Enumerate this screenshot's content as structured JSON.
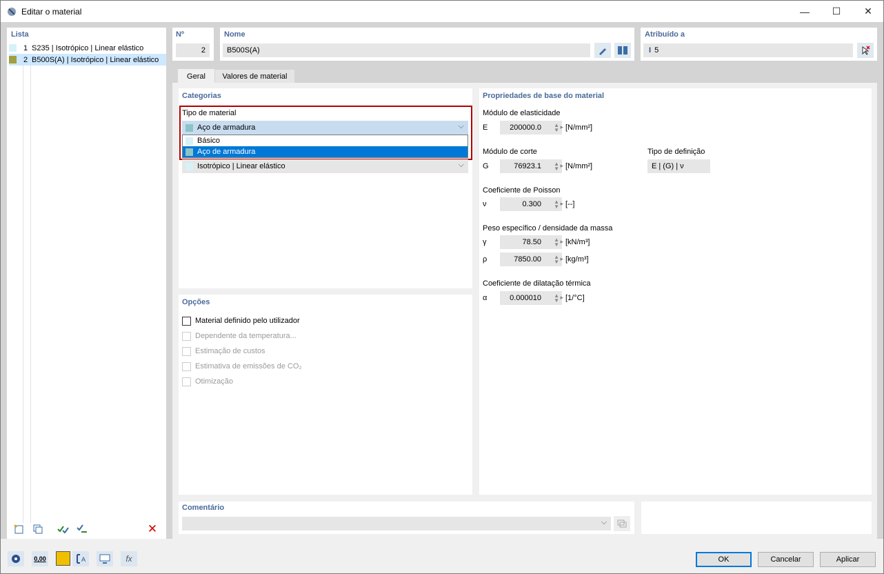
{
  "window": {
    "title": "Editar o material",
    "minimize": "—",
    "maximize": "☐",
    "close": "✕"
  },
  "list": {
    "header": "Lista",
    "items": [
      {
        "num": "1",
        "label": "S235 | Isotrópico | Linear elástico",
        "color": "#d6f2f8"
      },
      {
        "num": "2",
        "label": "B500S(A) | Isotrópico | Linear elástico",
        "color": "#a0a040"
      }
    ]
  },
  "no": {
    "header": "Nº",
    "value": "2"
  },
  "name": {
    "header": "Nome",
    "value": "B500S(A)"
  },
  "assigned": {
    "header": "Atribuído a",
    "value": "5"
  },
  "tabs": [
    "Geral",
    "Valores de material"
  ],
  "categories": {
    "header": "Categorias",
    "material_type_label": "Tipo de material",
    "selected": "Aço de armadura",
    "options": [
      "Básico",
      "Aço de armadura"
    ],
    "model_value": "Isotrópico | Linear elástico"
  },
  "options": {
    "header": "Opções",
    "items": [
      {
        "label": "Material definido pelo utilizador",
        "enabled": true
      },
      {
        "label": "Dependente da temperatura...",
        "enabled": false
      },
      {
        "label": "Estimação de custos",
        "enabled": false
      },
      {
        "label": "Estimativa de emissões de CO₂",
        "enabled": false
      },
      {
        "label": "Otimização",
        "enabled": false
      }
    ]
  },
  "props": {
    "header": "Propriedades de base do material",
    "elastic_label": "Módulo de elasticidade",
    "E_sym": "E",
    "E_val": "200000.0",
    "E_unit": "[N/mm²]",
    "shear_label": "Módulo de corte",
    "G_sym": "G",
    "G_val": "76923.1",
    "G_unit": "[N/mm²]",
    "deftype_label": "Tipo de definição",
    "deftype_val": "E | (G) | ν",
    "poisson_label": "Coeficiente de Poisson",
    "nu_sym": "ν",
    "nu_val": "0.300",
    "nu_unit": "[--]",
    "weight_label": "Peso específico / densidade da massa",
    "gamma_sym": "γ",
    "gamma_val": "78.50",
    "gamma_unit": "[kN/m³]",
    "rho_sym": "ρ",
    "rho_val": "7850.00",
    "rho_unit": "[kg/m³]",
    "thermal_label": "Coeficiente de dilatação térmica",
    "alpha_sym": "α",
    "alpha_val": "0.000010",
    "alpha_unit": "[1/°C]"
  },
  "comment": {
    "header": "Comentário",
    "value": ""
  },
  "footer": {
    "ok": "OK",
    "cancel": "Cancelar",
    "apply": "Aplicar",
    "units_icon_text": "0,00"
  },
  "colors": {
    "header": "#4a6a9a",
    "selection": "#0078d7",
    "highlight_border": "#b00000",
    "selected_row": "#cde8ff"
  }
}
